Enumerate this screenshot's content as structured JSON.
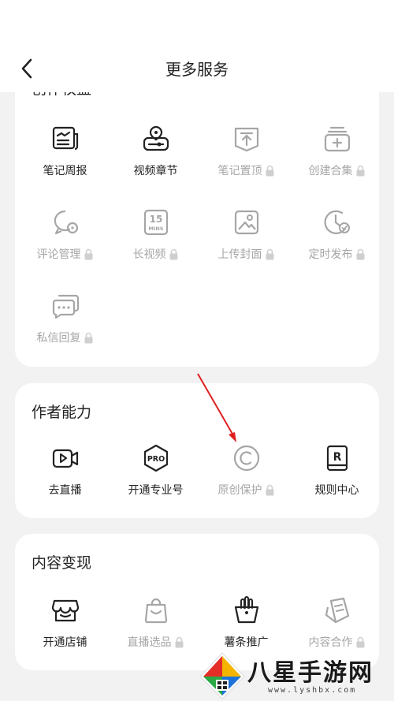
{
  "header": {
    "title": "更多服务"
  },
  "sections": [
    {
      "title": "创作权益",
      "items": [
        {
          "label": "笔记周报",
          "icon": "weekly-report-icon",
          "locked": false
        },
        {
          "label": "视频章节",
          "icon": "video-chapter-icon",
          "locked": false
        },
        {
          "label": "笔记置顶",
          "icon": "pin-top-icon",
          "locked": true
        },
        {
          "label": "创建合集",
          "icon": "create-collection-icon",
          "locked": true
        },
        {
          "label": "评论管理",
          "icon": "comment-manage-icon",
          "locked": true
        },
        {
          "label": "长视频",
          "icon": "long-video-icon",
          "locked": true
        },
        {
          "label": "上传封面",
          "icon": "upload-cover-icon",
          "locked": true
        },
        {
          "label": "定时发布",
          "icon": "scheduled-publish-icon",
          "locked": true
        },
        {
          "label": "私信回复",
          "icon": "dm-reply-icon",
          "locked": true
        }
      ]
    },
    {
      "title": "作者能力",
      "items": [
        {
          "label": "去直播",
          "icon": "live-camera-icon",
          "locked": false
        },
        {
          "label": "开通专业号",
          "icon": "pro-badge-icon",
          "locked": false
        },
        {
          "label": "原创保护",
          "icon": "copyright-icon",
          "locked": true
        },
        {
          "label": "规则中心",
          "icon": "rules-book-icon",
          "locked": false
        }
      ]
    },
    {
      "title": "内容变现",
      "items": [
        {
          "label": "开通店铺",
          "icon": "shop-icon",
          "locked": false
        },
        {
          "label": "直播选品",
          "icon": "shopping-bag-icon",
          "locked": true
        },
        {
          "label": "薯条推广",
          "icon": "fries-promo-icon",
          "locked": false
        },
        {
          "label": "内容合作",
          "icon": "content-coop-icon",
          "locked": true
        }
      ]
    }
  ],
  "icon_15_text": "15",
  "icon_mins_text": "MINS",
  "icon_pro_text": "PRO",
  "icon_r_text": "R",
  "watermark": {
    "text": "八星手游网",
    "url": "www.lyshbx.com"
  },
  "colors": {
    "active": "#222222",
    "locked": "#a6a6a6",
    "arrow": "#e02020"
  }
}
